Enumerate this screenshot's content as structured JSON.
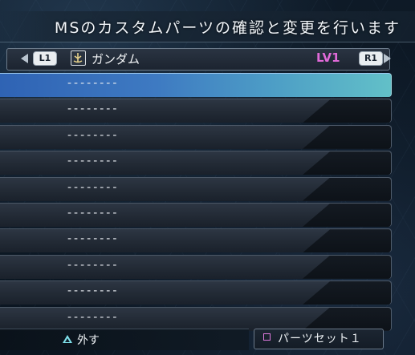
{
  "header": {
    "description": "MSのカスタムパーツの確認と変更を行います"
  },
  "unit": {
    "prev_button": "L1",
    "next_button": "R1",
    "faction_icon": "federation-emblem-icon",
    "name": "ガンダム",
    "level": "LV1",
    "level_color": "#e06ad8"
  },
  "slots": [
    {
      "label": "--------",
      "selected": true
    },
    {
      "label": "--------",
      "selected": false
    },
    {
      "label": "--------",
      "selected": false
    },
    {
      "label": "--------",
      "selected": false
    },
    {
      "label": "--------",
      "selected": false
    },
    {
      "label": "--------",
      "selected": false
    },
    {
      "label": "--------",
      "selected": false
    },
    {
      "label": "--------",
      "selected": false
    },
    {
      "label": "--------",
      "selected": false
    },
    {
      "label": "--------",
      "selected": false
    }
  ],
  "footer": {
    "triangle_icon": "triangle-button-icon",
    "remove_label": "外す",
    "square_icon": "square-button-icon",
    "partset_label": "パーツセット１"
  },
  "colors": {
    "selected_slot": "#3e7ac2",
    "triangle": "#7fe0ea",
    "square": "#e07adf"
  }
}
